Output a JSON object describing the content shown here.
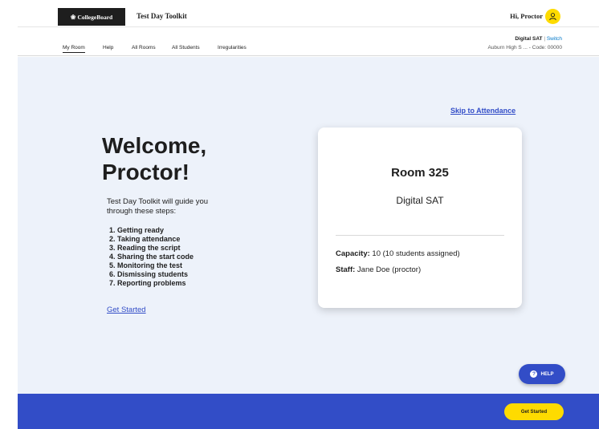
{
  "header": {
    "logo_text": "CollegeBoard",
    "logo_icon": "acorn-icon",
    "app_title": "Test Day Toolkit",
    "greeting": "Hi, Proctor",
    "avatar_icon": "user-icon",
    "brand_yellow": "#fedb00"
  },
  "nav": {
    "items": [
      {
        "label": "My Room",
        "active": true
      },
      {
        "label": "Help"
      },
      {
        "label": "All Rooms"
      },
      {
        "label": "All Students"
      },
      {
        "label": "Irregularities"
      }
    ],
    "test_name": "Digital SAT",
    "separator": "|",
    "switch_label": "Switch",
    "school_code": "Auburn High S ... - Code: 00000"
  },
  "main": {
    "skip_link": "Skip to Attendance",
    "welcome_title": "Welcome, Proctor!",
    "intro": "Test Day Toolkit will guide you through these steps:",
    "steps": [
      "1. Getting ready",
      "2. Taking attendance",
      "3. Reading the script",
      "4. Sharing the start code",
      "5. Monitoring the test",
      "6. Dismissing students",
      "7. Reporting problems"
    ],
    "get_started_link": "Get Started",
    "background": "#edf2fa"
  },
  "room_card": {
    "room": "Room 325",
    "test": "Digital SAT",
    "capacity_label": "Capacity:",
    "capacity_value": "10 (10 students assigned)",
    "staff_label": "Staff:",
    "staff_value": "Jane Doe (proctor)"
  },
  "help_button": {
    "label": "HELP",
    "icon": "question-icon"
  },
  "footer": {
    "button_label": "Get Started",
    "color": "#324dc7"
  }
}
